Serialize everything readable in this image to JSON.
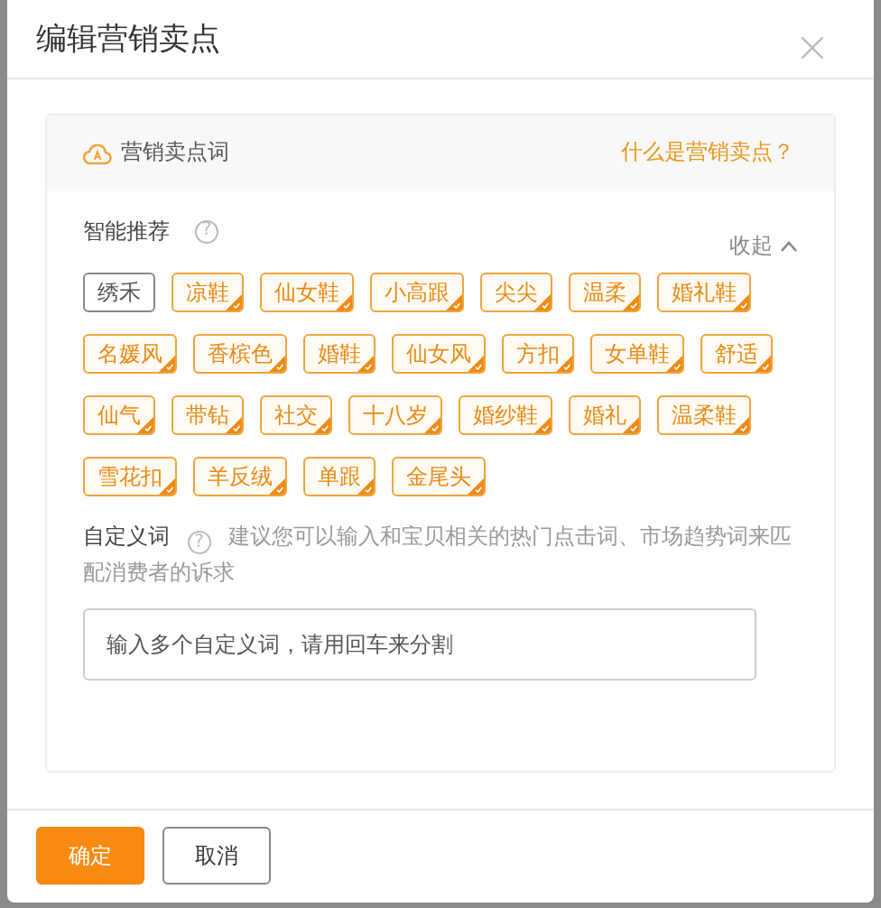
{
  "dialog": {
    "title": "编辑营销卖点",
    "close": "×"
  },
  "panel": {
    "heading": "营销卖点词",
    "help_link": "什么是营销卖点？"
  },
  "smart": {
    "label": "智能推荐",
    "help": "?",
    "collapse": "收起",
    "tags": [
      {
        "label": "绣禾",
        "selected": false
      },
      {
        "label": "凉鞋",
        "selected": true
      },
      {
        "label": "仙女鞋",
        "selected": true
      },
      {
        "label": "小高跟",
        "selected": true
      },
      {
        "label": "尖尖",
        "selected": true
      },
      {
        "label": "温柔",
        "selected": true
      },
      {
        "label": "婚礼鞋",
        "selected": true
      },
      {
        "label": "名媛风",
        "selected": true
      },
      {
        "label": "香槟色",
        "selected": true
      },
      {
        "label": "婚鞋",
        "selected": true
      },
      {
        "label": "仙女风",
        "selected": true
      },
      {
        "label": "方扣",
        "selected": true
      },
      {
        "label": "女单鞋",
        "selected": true
      },
      {
        "label": "舒适",
        "selected": true
      },
      {
        "label": "仙气",
        "selected": true
      },
      {
        "label": "带钻",
        "selected": true
      },
      {
        "label": "社交",
        "selected": true
      },
      {
        "label": "十八岁",
        "selected": true
      },
      {
        "label": "婚纱鞋",
        "selected": true
      },
      {
        "label": "婚礼",
        "selected": true
      },
      {
        "label": "温柔鞋",
        "selected": true
      },
      {
        "label": "雪花扣",
        "selected": true
      },
      {
        "label": "羊反绒",
        "selected": true
      },
      {
        "label": "单跟",
        "selected": true
      },
      {
        "label": "金尾头",
        "selected": true
      }
    ]
  },
  "custom": {
    "label": "自定义词",
    "help": "?",
    "hint": "建议您可以输入和宝贝相关的热门点击词、市场趋势词来匹配消费者的诉求",
    "placeholder": "输入多个自定义词，请用回车来分割"
  },
  "buttons": [
    {
      "label": "确定",
      "kind": "primary"
    },
    {
      "label": "取消",
      "kind": "secondary"
    }
  ]
}
